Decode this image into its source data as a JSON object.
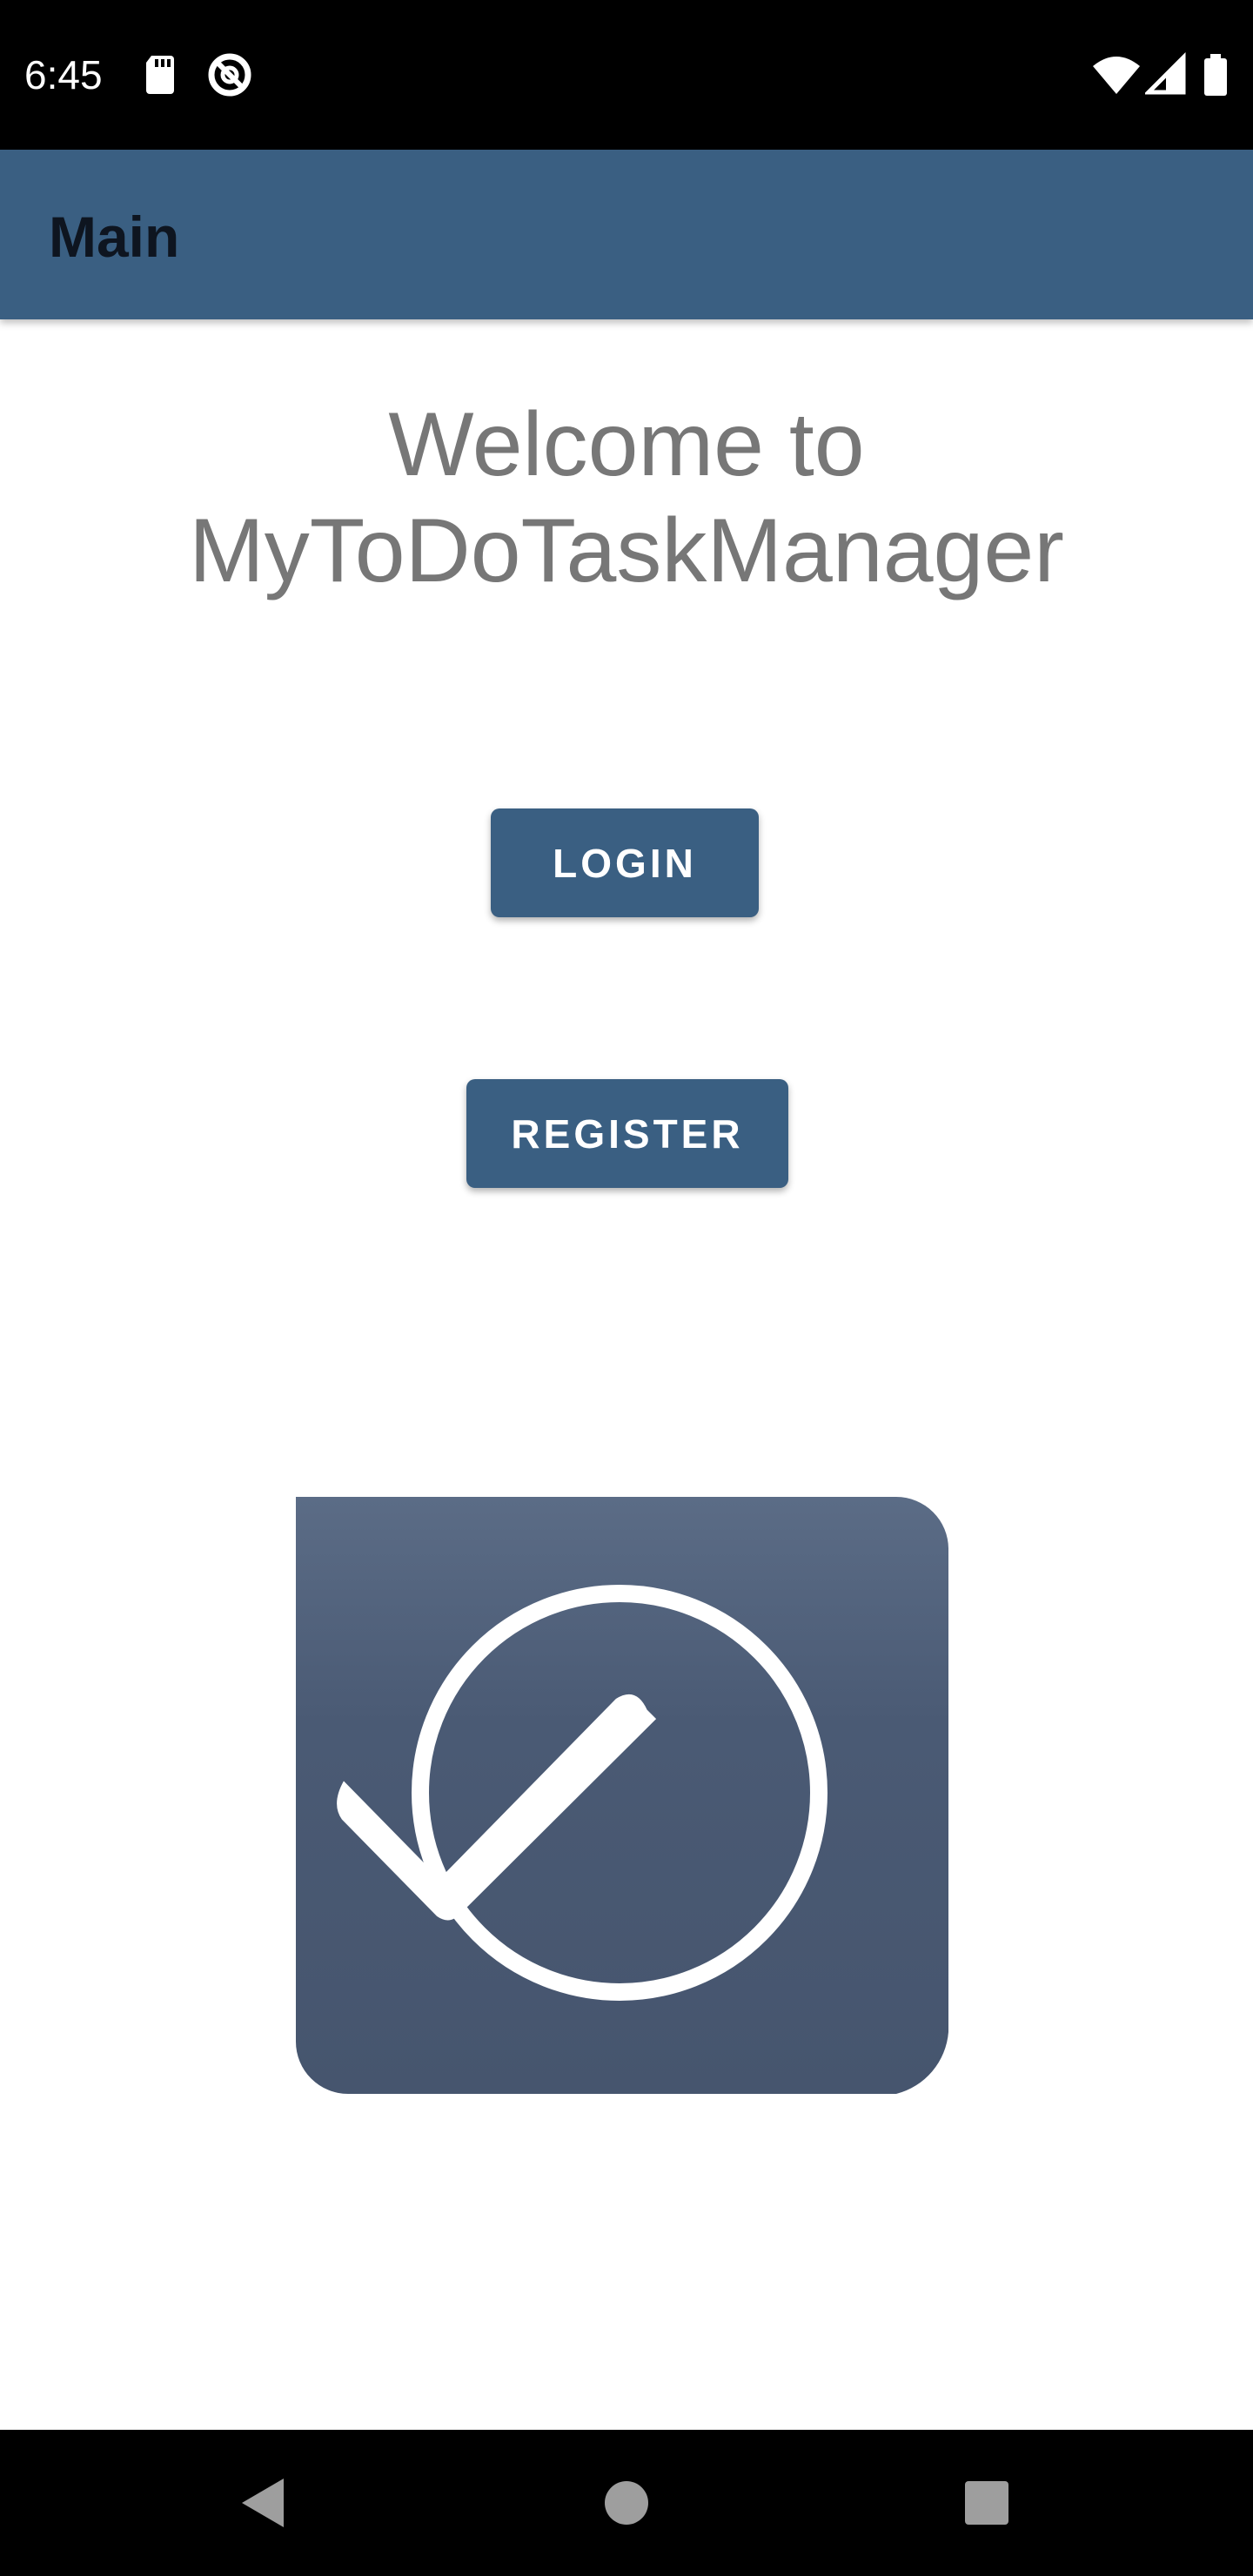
{
  "status_bar": {
    "time": "6:45",
    "left_icons": [
      "sd-card-icon",
      "data-saver-icon"
    ],
    "right_icons": [
      "wifi-icon",
      "signal-icon",
      "battery-icon"
    ]
  },
  "app_bar": {
    "title": "Main"
  },
  "welcome": {
    "line1": "Welcome to",
    "line2": "MyToDoTaskManager"
  },
  "buttons": {
    "login_label": "LOGIN",
    "register_label": "REGISTER"
  },
  "logo": {
    "icon": "checkmark-circle-icon"
  },
  "nav_bar": {
    "icons": [
      "back-icon",
      "home-icon",
      "recents-icon"
    ]
  },
  "colors": {
    "primary": "#3a5f82",
    "heading_text": "#777777",
    "logo_top": "#5b6c86",
    "logo_bottom": "#46556e"
  }
}
